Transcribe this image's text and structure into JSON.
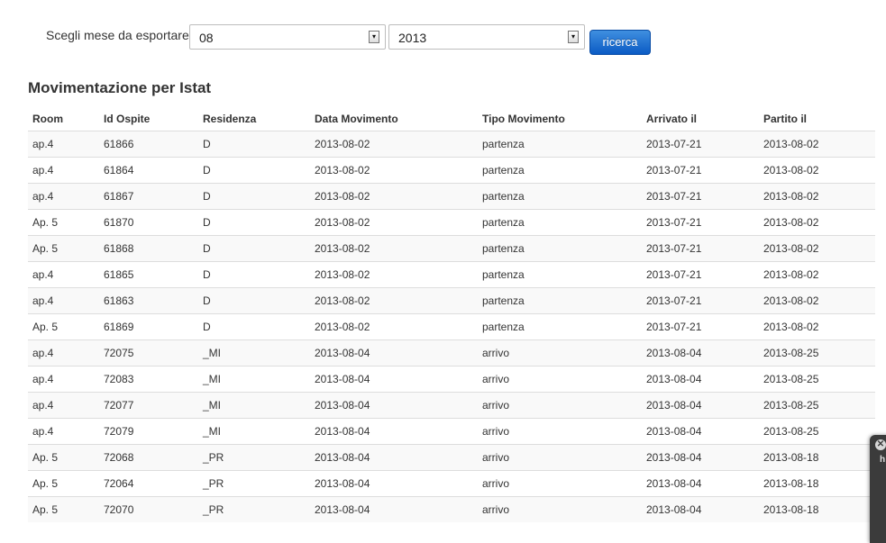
{
  "filter": {
    "label": "Scegli mese da esportare",
    "month": "08",
    "year": "2013",
    "search_label": "ricerca"
  },
  "section_title": "Movimentazione per Istat",
  "table": {
    "columns": [
      "Room",
      "Id Ospite",
      "Residenza",
      "Data Movimento",
      "Tipo Movimento",
      "Arrivato il",
      "Partito il"
    ],
    "rows": [
      [
        "ap.4",
        "61866",
        "D",
        "2013-08-02",
        "partenza",
        "2013-07-21",
        "2013-08-02"
      ],
      [
        "ap.4",
        "61864",
        "D",
        "2013-08-02",
        "partenza",
        "2013-07-21",
        "2013-08-02"
      ],
      [
        "ap.4",
        "61867",
        "D",
        "2013-08-02",
        "partenza",
        "2013-07-21",
        "2013-08-02"
      ],
      [
        "Ap. 5",
        "61870",
        "D",
        "2013-08-02",
        "partenza",
        "2013-07-21",
        "2013-08-02"
      ],
      [
        "Ap. 5",
        "61868",
        "D",
        "2013-08-02",
        "partenza",
        "2013-07-21",
        "2013-08-02"
      ],
      [
        "ap.4",
        "61865",
        "D",
        "2013-08-02",
        "partenza",
        "2013-07-21",
        "2013-08-02"
      ],
      [
        "ap.4",
        "61863",
        "D",
        "2013-08-02",
        "partenza",
        "2013-07-21",
        "2013-08-02"
      ],
      [
        "Ap. 5",
        "61869",
        "D",
        "2013-08-02",
        "partenza",
        "2013-07-21",
        "2013-08-02"
      ],
      [
        "ap.4",
        "72075",
        "_MI",
        "2013-08-04",
        "arrivo",
        "2013-08-04",
        "2013-08-25"
      ],
      [
        "ap.4",
        "72083",
        "_MI",
        "2013-08-04",
        "arrivo",
        "2013-08-04",
        "2013-08-25"
      ],
      [
        "ap.4",
        "72077",
        "_MI",
        "2013-08-04",
        "arrivo",
        "2013-08-04",
        "2013-08-25"
      ],
      [
        "ap.4",
        "72079",
        "_MI",
        "2013-08-04",
        "arrivo",
        "2013-08-04",
        "2013-08-25"
      ],
      [
        "Ap. 5",
        "72068",
        "_PR",
        "2013-08-04",
        "arrivo",
        "2013-08-04",
        "2013-08-18"
      ],
      [
        "Ap. 5",
        "72064",
        "_PR",
        "2013-08-04",
        "arrivo",
        "2013-08-04",
        "2013-08-18"
      ],
      [
        "Ap. 5",
        "72070",
        "_PR",
        "2013-08-04",
        "arrivo",
        "2013-08-04",
        "2013-08-18"
      ]
    ]
  },
  "popup": {
    "close_icon": "close-icon",
    "text": "h"
  }
}
